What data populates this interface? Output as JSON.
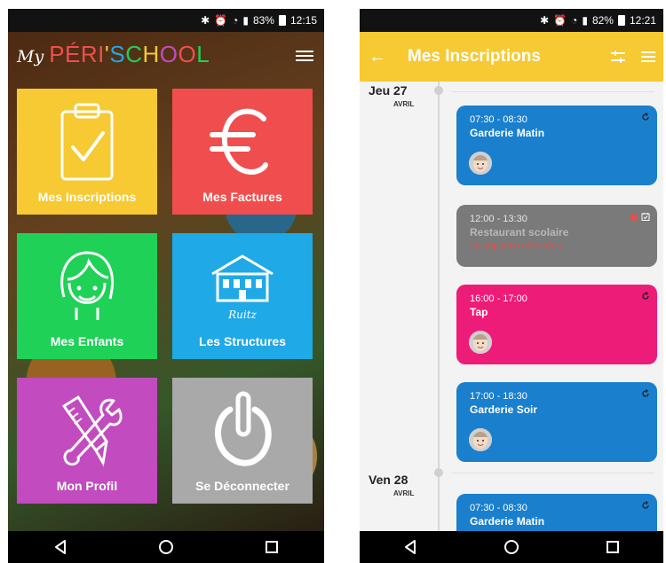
{
  "left": {
    "status": {
      "battery": "83%",
      "time": "12:15"
    },
    "logo": {
      "my": "My",
      "peri": "PÉRI'SCHOOL"
    },
    "tiles": [
      {
        "label": "Mes Inscriptions",
        "color": "#f7c932",
        "icon": "clipboard-check-icon"
      },
      {
        "label": "Mes Factures",
        "color": "#f04e4e",
        "icon": "euro-icon"
      },
      {
        "label": "Mes Enfants",
        "color": "#1fd157",
        "icon": "child-face-icon"
      },
      {
        "label": "Les Structures",
        "color": "#1fa9e6",
        "icon": "school-building-icon",
        "icon_caption": "Ruitz"
      },
      {
        "label": "Mon Profil",
        "color": "#c14bbf",
        "icon": "tools-icon"
      },
      {
        "label": "Se Déconnecter",
        "color": "#a9a9a9",
        "icon": "power-icon"
      }
    ]
  },
  "right": {
    "status": {
      "battery": "82%",
      "time": "12:21"
    },
    "appbar": {
      "title": "Mes Inscriptions",
      "color": "#f7c932"
    },
    "days": [
      {
        "name": "Jeu 27",
        "month": "AVRIL"
      },
      {
        "name": "Ven 28",
        "month": "AVRIL"
      }
    ],
    "cards": [
      {
        "time": "07:30 - 08:30",
        "name": "Garderie Matin",
        "sub": "",
        "color": "#1a7fcc"
      },
      {
        "time": "12:00 - 13:30",
        "name": "Restaurant scolaire",
        "sub": "Inscriptions clôturées",
        "color": "#7a7a7a"
      },
      {
        "time": "16:00 - 17:00",
        "name": "Tap",
        "sub": "",
        "color": "#ee1c79"
      },
      {
        "time": "17:00 - 18:30",
        "name": "Garderie Soir",
        "sub": "",
        "color": "#1a7fcc"
      },
      {
        "time": "07:30 - 08:30",
        "name": "Garderie Matin",
        "sub": "",
        "color": "#1a7fcc"
      }
    ]
  }
}
